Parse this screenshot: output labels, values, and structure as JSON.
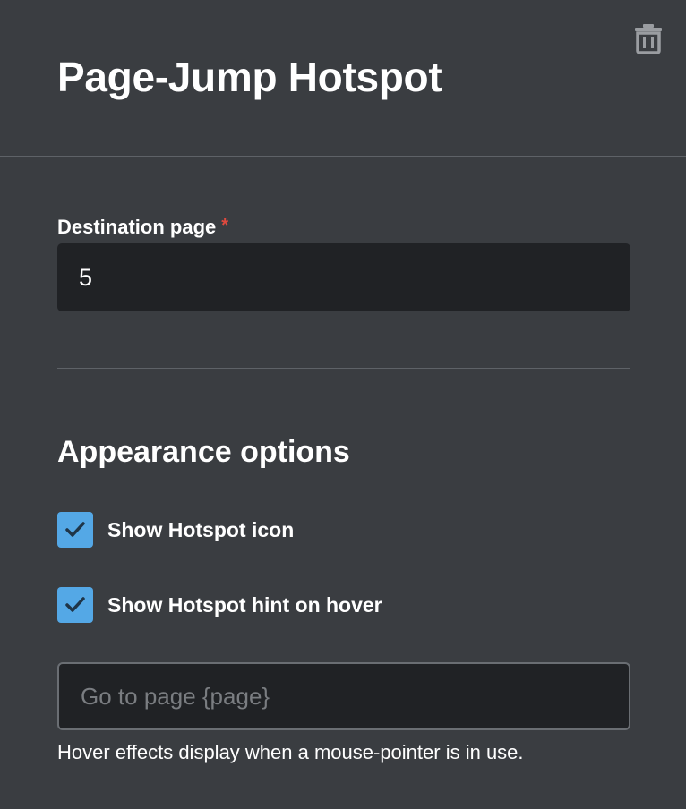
{
  "header": {
    "title": "Page-Jump Hotspot",
    "delete_icon": "trash-icon"
  },
  "destination": {
    "label": "Destination page",
    "required_mark": "*",
    "value": "5"
  },
  "appearance": {
    "title": "Appearance options",
    "options": [
      {
        "label": "Show Hotspot icon",
        "checked": true
      },
      {
        "label": "Show Hotspot hint on hover",
        "checked": true
      }
    ],
    "hint_input": {
      "value": "",
      "placeholder": "Go to page {page}"
    },
    "help_text": "Hover effects display when a mouse-pointer is in use."
  },
  "colors": {
    "background": "#3a3d41",
    "input_background": "#202225",
    "checkbox_accent": "#54a8e6",
    "required_star": "#e0493e"
  }
}
